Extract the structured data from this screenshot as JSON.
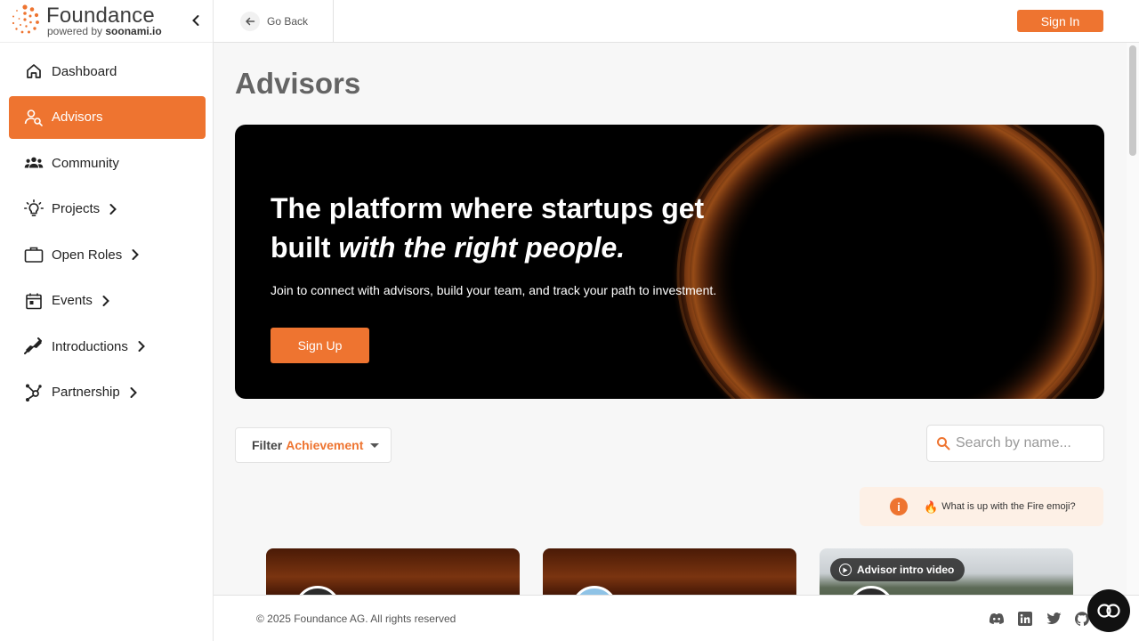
{
  "brand": {
    "name": "Foundance",
    "powered_prefix": "powered by ",
    "powered_brand": "soonami.io",
    "accent_color": "#ee7430"
  },
  "sidebar": {
    "collapse_icon": "chevron-left-icon",
    "items": [
      {
        "label": "Dashboard",
        "icon": "home-icon",
        "has_submenu": false,
        "active": false
      },
      {
        "label": "Advisors",
        "icon": "person-search-icon",
        "has_submenu": false,
        "active": true
      },
      {
        "label": "Community",
        "icon": "group-icon",
        "has_submenu": false,
        "active": false
      },
      {
        "label": "Projects",
        "icon": "lightbulb-icon",
        "has_submenu": true,
        "active": false
      },
      {
        "label": "Open Roles",
        "icon": "briefcase-icon",
        "has_submenu": true,
        "active": false
      },
      {
        "label": "Events",
        "icon": "calendar-icon",
        "has_submenu": true,
        "active": false
      },
      {
        "label": "Introductions",
        "icon": "handshake-icon",
        "has_submenu": true,
        "active": false
      },
      {
        "label": "Partnership",
        "icon": "hub-icon",
        "has_submenu": true,
        "active": false
      }
    ]
  },
  "topbar": {
    "go_back_label": "Go Back",
    "sign_in_label": "Sign In"
  },
  "main": {
    "page_title": "Advisors",
    "hero": {
      "title_line1": "The platform where startups get",
      "title_line2_plain": "built ",
      "title_line2_emphasis": "with the right people.",
      "subtitle": "Join to connect with advisors, build your team, and track your path to investment.",
      "cta_label": "Sign Up"
    },
    "filter": {
      "label": "Filter",
      "value": "Achievement"
    },
    "search": {
      "placeholder": "Search by name...",
      "value": ""
    },
    "fire_info": {
      "emoji": "🔥",
      "text": "What is up with the Fire emoji?"
    },
    "cards": [
      {
        "background": "fire",
        "video_chip": null
      },
      {
        "background": "fire",
        "video_chip": null
      },
      {
        "background": "photo",
        "video_chip": "Advisor intro video"
      }
    ]
  },
  "footer": {
    "copyright": "© 2025 Foundance AG. All rights reserved",
    "social_icons": [
      "discord-icon",
      "linkedin-icon",
      "twitter-icon",
      "github-icon"
    ]
  },
  "chat_widget_icon": "chat-icon"
}
